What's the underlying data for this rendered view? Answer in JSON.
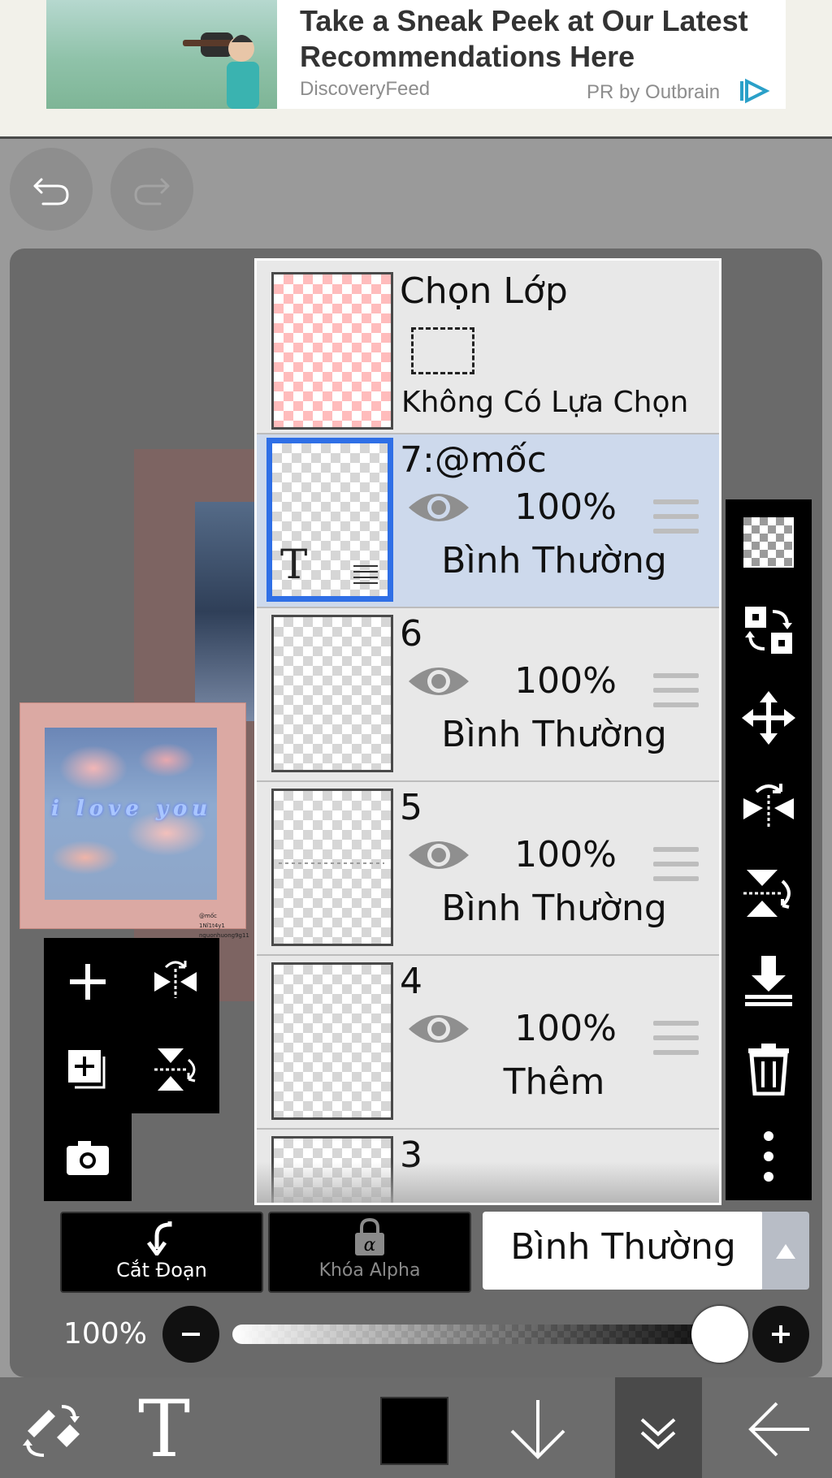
{
  "ad": {
    "title": "Take a Sneak Peek at Our Latest Recommendations Here",
    "source": "DiscoveryFeed",
    "pr": "PR by Outbrain"
  },
  "history": {
    "undo_icon": "undo-icon",
    "redo_icon": "redo-icon"
  },
  "preview": {
    "text": "i love you",
    "credit_lines": [
      "@mốc",
      "1Nĩ1t4y1",
      "nguonhuong9g11"
    ]
  },
  "layers": {
    "selection": {
      "title": "Chọn Lớp",
      "status": "Không Có Lựa Chọn"
    },
    "items": [
      {
        "name": "7:@mốc",
        "opacity": "100%",
        "blend": "Bình Thường",
        "selected": true,
        "thumb_glyph": "T"
      },
      {
        "name": "6",
        "opacity": "100%",
        "blend": "Bình Thường",
        "selected": false
      },
      {
        "name": "5",
        "opacity": "100%",
        "blend": "Bình Thường",
        "selected": false
      },
      {
        "name": "4",
        "opacity": "100%",
        "blend": "Thêm",
        "selected": false
      },
      {
        "name": "3",
        "opacity": "",
        "blend": "",
        "selected": false
      }
    ]
  },
  "left_tools": [
    "add-layer-icon",
    "flip-horizontal-icon",
    "add-copy-icon",
    "flip-vertical-rotate-icon",
    "camera-icon"
  ],
  "right_tools": [
    "transparency-icon",
    "layer-swap-icon",
    "move-icon",
    "flip-horizontal-icon",
    "flip-vertical-icon",
    "merge-down-icon",
    "trash-icon",
    "more-icon"
  ],
  "controls": {
    "clip_label": "Cắt Đoạn",
    "alpha_lock_label": "Khóa Alpha",
    "blend_mode": "Bình Thường",
    "opacity_label": "100%",
    "opacity_value": 1.0
  },
  "bottom_bar": {
    "tools": [
      "brush-eraser-swap-icon",
      "text-tool-icon",
      "color-swatch",
      "download-arrow-icon",
      "collapse-icon",
      "back-arrow-icon"
    ],
    "text_glyph": "T",
    "color": "#000000"
  }
}
